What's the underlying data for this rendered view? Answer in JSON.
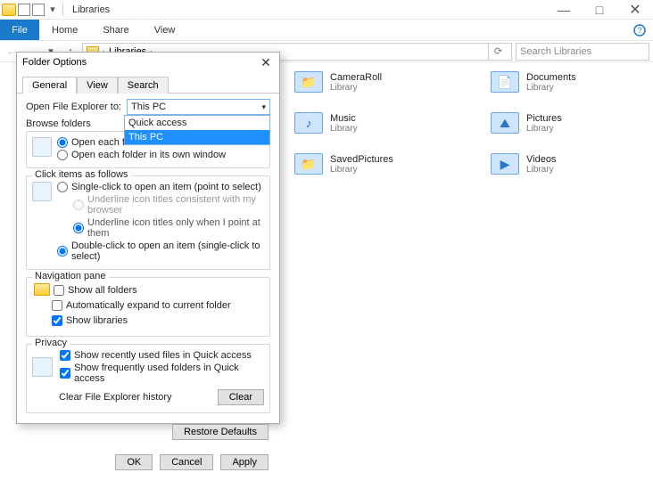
{
  "window": {
    "title": "Libraries",
    "controls": {
      "minimize": "—",
      "maximize": "□",
      "close": "✕"
    }
  },
  "ribbon": {
    "file": "File",
    "tabs": [
      "Home",
      "Share",
      "View"
    ],
    "help_icon": "?"
  },
  "address": {
    "back": "←",
    "forward": "→",
    "dropdown": "▾",
    "up": "↑",
    "path_prefix": "›",
    "path": "Libraries",
    "path_suffix": "›",
    "refresh": "⟳",
    "search_placeholder": "Search Libraries"
  },
  "libraries": [
    {
      "name": "CameraRoll",
      "sub": "Library",
      "glyph": "📁"
    },
    {
      "name": "Documents",
      "sub": "Library",
      "glyph": "📄"
    },
    {
      "name": "Music",
      "sub": "Library",
      "glyph": "♪"
    },
    {
      "name": "Pictures",
      "sub": "Library",
      "glyph": "⛰"
    },
    {
      "name": "SavedPictures",
      "sub": "Library",
      "glyph": "📁"
    },
    {
      "name": "Videos",
      "sub": "Library",
      "glyph": "▶"
    }
  ],
  "dialog": {
    "title": "Folder Options",
    "close": "✕",
    "tabs": {
      "general": "General",
      "view": "View",
      "search": "Search"
    },
    "open_label": "Open File Explorer to:",
    "combo_value": "This PC",
    "combo_options": [
      "Quick access",
      "This PC"
    ],
    "browse": {
      "legend": "Browse folders",
      "opt_same": "Open each folder in the same window",
      "opt_own": "Open each folder in its own window"
    },
    "click": {
      "legend": "Click items as follows",
      "opt_single": "Single-click to open an item (point to select)",
      "sub_browser": "Underline icon titles consistent with my browser",
      "sub_point": "Underline icon titles only when I point at them",
      "opt_double": "Double-click to open an item (single-click to select)"
    },
    "nav": {
      "legend": "Navigation pane",
      "show_all": "Show all folders",
      "auto_expand": "Automatically expand to current folder",
      "show_libs": "Show libraries"
    },
    "privacy": {
      "legend": "Privacy",
      "recent_files": "Show recently used files in Quick access",
      "freq_folders": "Show frequently used folders in Quick access",
      "clear_label": "Clear File Explorer history",
      "clear_btn": "Clear"
    },
    "restore": "Restore Defaults",
    "buttons": {
      "ok": "OK",
      "cancel": "Cancel",
      "apply": "Apply"
    }
  }
}
